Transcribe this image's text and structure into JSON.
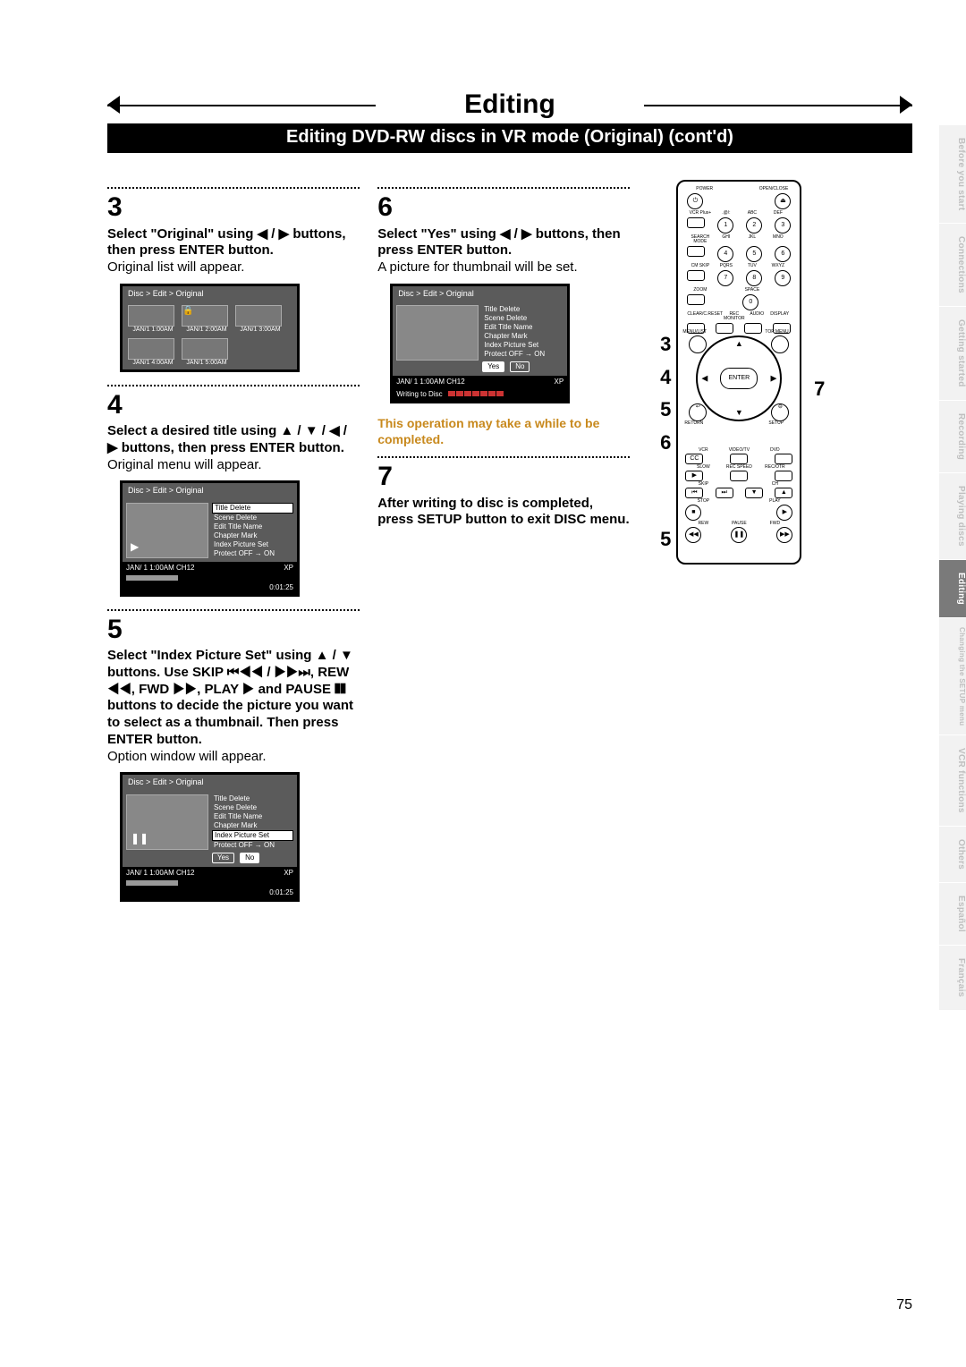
{
  "chapter": "Editing",
  "subbanner": "Editing DVD-RW discs in VR mode (Original) (cont'd)",
  "page_number": "75",
  "side_tabs": [
    {
      "label": "Before you start"
    },
    {
      "label": "Connections"
    },
    {
      "label": "Getting started"
    },
    {
      "label": "Recording"
    },
    {
      "label": "Playing discs"
    },
    {
      "label": "Editing",
      "current": true
    },
    {
      "label": "Changing the SETUP menu"
    },
    {
      "label": "VCR functions"
    },
    {
      "label": "Others"
    },
    {
      "label": "Español"
    },
    {
      "label": "Français"
    }
  ],
  "steps": {
    "s3": {
      "num": "3",
      "bold": "Select \"Original\" using ◀ / ▶ buttons, then press ENTER button.",
      "plain": "Original list will appear."
    },
    "s4": {
      "num": "4",
      "bold": "Select a desired title using ▲ / ▼ / ◀ / ▶ buttons, then press ENTER button.",
      "plain": "Original menu will appear."
    },
    "s5": {
      "num": "5",
      "bold": "Select \"Index Picture Set\" using ▲ / ▼ buttons. Use SKIP ⏮◀◀ / ▶▶⏭, REW ◀◀, FWD ▶▶, PLAY ▶ and PAUSE ❚❚ buttons to decide the picture you want to select as a thumbnail. Then press ENTER button.",
      "plain": "Option window will appear."
    },
    "s6": {
      "num": "6",
      "bold": "Select \"Yes\" using ◀ / ▶ buttons, then press ENTER button.",
      "plain": "A picture for thumbnail will be set."
    },
    "note6": "This operation may take a while to be completed.",
    "s7": {
      "num": "7",
      "bold": "After writing to disc is completed, press SETUP button to exit DISC menu."
    }
  },
  "ui_common": {
    "breadcrumb": "Disc > Edit > Original",
    "menu_items": [
      "Title Delete",
      "Scene Delete",
      "Edit Title Name",
      "Chapter Mark",
      "Index Picture Set",
      "Protect OFF → ON"
    ],
    "status_line_left": "JAN/ 1   1:00AM  CH12",
    "status_mode": "XP",
    "elapsed": "0:01:25",
    "yes": "Yes",
    "no": "No",
    "writing": "Writing to Disc"
  },
  "thumbs": [
    {
      "label": "JAN/1  1:00AM"
    },
    {
      "label": "JAN/1  2:00AM",
      "locked": true
    },
    {
      "label": "JAN/1  3:00AM"
    },
    {
      "label": "JAN/1  4:00AM"
    },
    {
      "label": "JAN/1  5:00AM"
    }
  ],
  "callouts_left": [
    "3",
    "4",
    "5",
    "6"
  ],
  "callout_left_low": "5",
  "callout_right": "7",
  "remote": {
    "top_labels": [
      "POWER",
      "OPEN/CLOSE"
    ],
    "keypad_labels": [
      ".@/:",
      "ABC",
      "DEF",
      "GHI",
      "JKL",
      "MNO",
      "PQRS",
      "TUV",
      "WXYZ",
      "SPACE"
    ],
    "keypad_digits": [
      "1",
      "2",
      "3",
      "4",
      "5",
      "6",
      "7",
      "8",
      "9",
      "0"
    ],
    "row_side": [
      "VCR Plus+",
      "SEARCH MODE",
      "CM SKIP",
      "ZOOM"
    ],
    "four_btns": [
      "CLEAR/C.RESET",
      "REC MONITOR",
      "AUDIO",
      "DISPLAY"
    ],
    "wheel": {
      "center": "ENTER",
      "tl": "MENU/LIST",
      "tr": "TOP MENU",
      "bl": "RETURN",
      "br": "SETUP"
    },
    "transport_labels": [
      "VCR",
      "VIDEO/TV",
      "DVD",
      "CC",
      "SLOW",
      "REC SPEED",
      "REC/OTR",
      "SKIP",
      "CH",
      "STOP",
      "PLAY",
      "REW",
      "PAUSE",
      "FWD"
    ]
  }
}
